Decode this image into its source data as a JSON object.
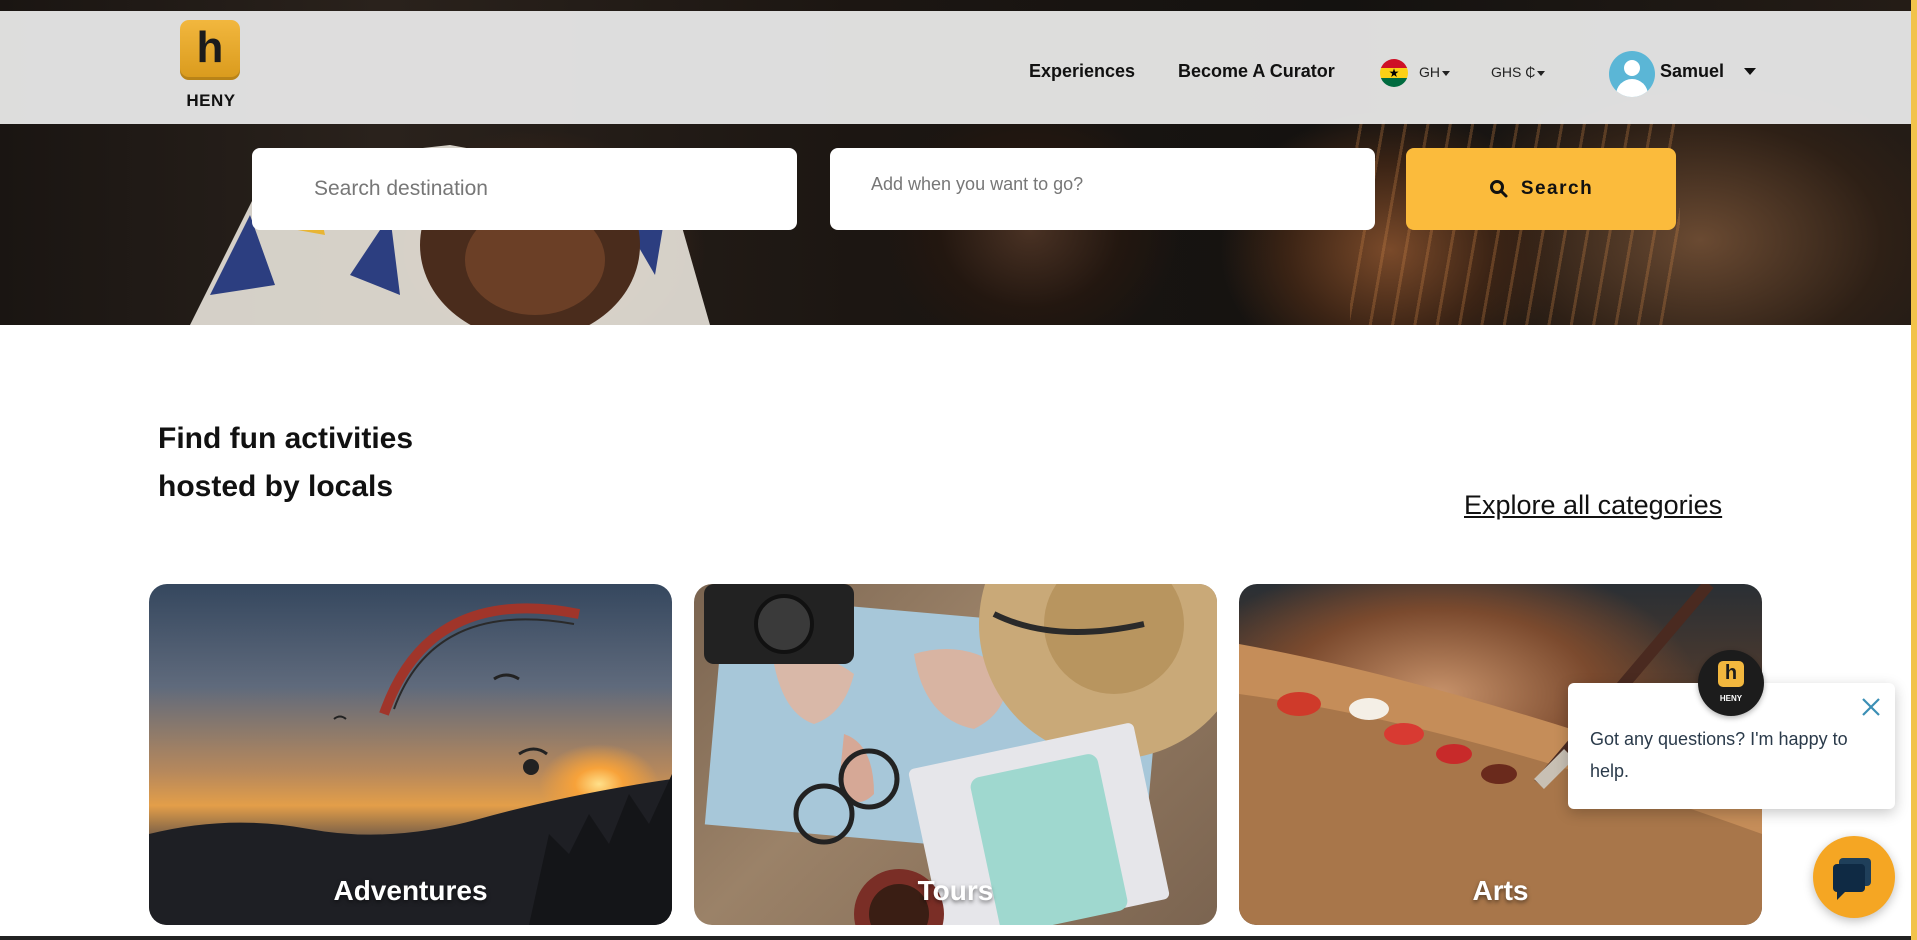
{
  "brand": {
    "logo_letter": "h",
    "name": "HENY"
  },
  "nav": {
    "experiences": "Experiences",
    "become_curator": "Become A Curator",
    "country": "GH",
    "currency": "GHS ₵",
    "user_name": "Samuel"
  },
  "search": {
    "destination_placeholder": "Search destination",
    "date_placeholder": "Add when you want to go?",
    "button_label": "Search"
  },
  "section": {
    "heading_line1": "Find fun activities",
    "heading_line2": "hosted by locals",
    "explore_link": "Explore all categories"
  },
  "categories": [
    {
      "label": "Adventures"
    },
    {
      "label": "Tours"
    },
    {
      "label": "Arts"
    }
  ],
  "chat": {
    "message": "Got any questions? I'm happy to help.",
    "avatar_letter": "h",
    "avatar_text": "HENY"
  },
  "colors": {
    "accent": "#fbbb3c",
    "chat_launcher": "#f5a623",
    "avatar_bg": "#5bb6d6",
    "flag_red": "#ce1126",
    "flag_gold": "#fcd116",
    "flag_green": "#006b3f"
  }
}
